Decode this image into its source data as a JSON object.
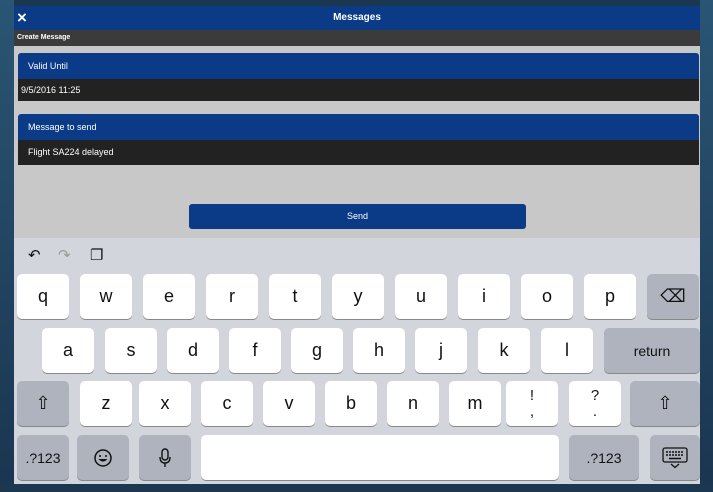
{
  "header": {
    "title": "Messages",
    "close_icon": "×"
  },
  "subheader": {
    "title": "Create Message"
  },
  "valid_until": {
    "label": "Valid Until",
    "value": "9/5/2016 11:25"
  },
  "message": {
    "label": "Message to send",
    "value": "Flight SA224 delayed"
  },
  "send_label": "Send",
  "keyboard": {
    "toolbar": [
      "undo-icon",
      "redo-icon",
      "paste-icon"
    ],
    "row1": [
      "q",
      "w",
      "e",
      "r",
      "t",
      "y",
      "u",
      "i",
      "o",
      "p"
    ],
    "row2": [
      "a",
      "s",
      "d",
      "f",
      "g",
      "h",
      "j",
      "k",
      "l"
    ],
    "row3": [
      "z",
      "x",
      "c",
      "v",
      "b",
      "n",
      "m"
    ],
    "punct1": {
      "top": "!",
      "bottom": ","
    },
    "punct2": {
      "top": "?",
      "bottom": "."
    },
    "return_label": "return",
    "numbers_label": ".?123",
    "delete_icon": "⌫",
    "shift_icon": "⇧"
  },
  "colors": {
    "accent": "#0b3a86",
    "keyboard_bg": "#d2d5db"
  }
}
